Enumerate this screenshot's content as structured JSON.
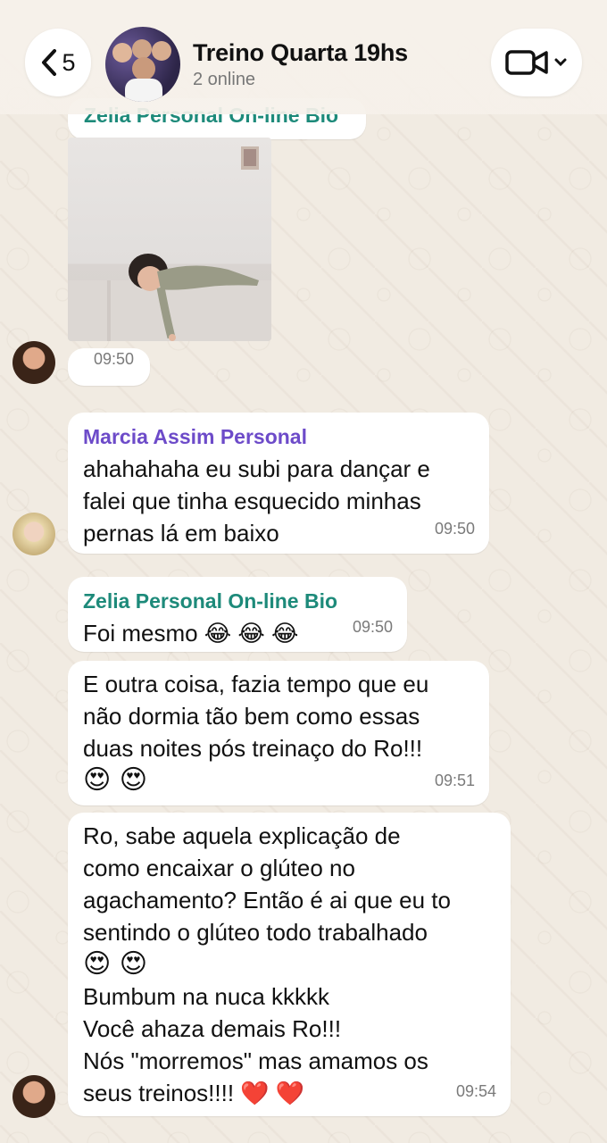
{
  "header": {
    "back_count": "5",
    "title": "Treino Quarta 19hs",
    "subtitle": "2 online"
  },
  "messages": [
    {
      "sender": "Zelia Personal On-line Bio",
      "type": "image",
      "time": "09:50"
    },
    {
      "sender": "Marcia Assim Personal",
      "lines": [
        "ahahahaha eu subi para dançar e",
        "falei que tinha esquecido minhas",
        "pernas lá em baixo"
      ],
      "time": "09:50"
    },
    {
      "sender": "Zelia Personal On-line Bio",
      "lines": [
        "Foi mesmo 😂 😂 😂"
      ],
      "time": "09:50"
    },
    {
      "lines": [
        "E outra coisa, fazia tempo que eu",
        "não dormia tão bem como essas",
        "duas noites pós treinaço do Ro!!!",
        "😍 😍"
      ],
      "time": "09:51"
    },
    {
      "lines": [
        "Ro, sabe aquela explicação de",
        "como encaixar o glúteo no",
        "agachamento? Então é ai que eu to",
        "sentindo o glúteo todo trabalhado",
        "😍 😍",
        "Bumbum na nuca kkkkk",
        "Você ahaza demais Ro!!!",
        "Nós \"morremos\" mas amamos os",
        "seus treinos!!!! ❤️ ❤️"
      ],
      "time": "09:54"
    }
  ],
  "colors": {
    "zelia": "#1d8a7a",
    "marcia": "#6d4bc9"
  }
}
